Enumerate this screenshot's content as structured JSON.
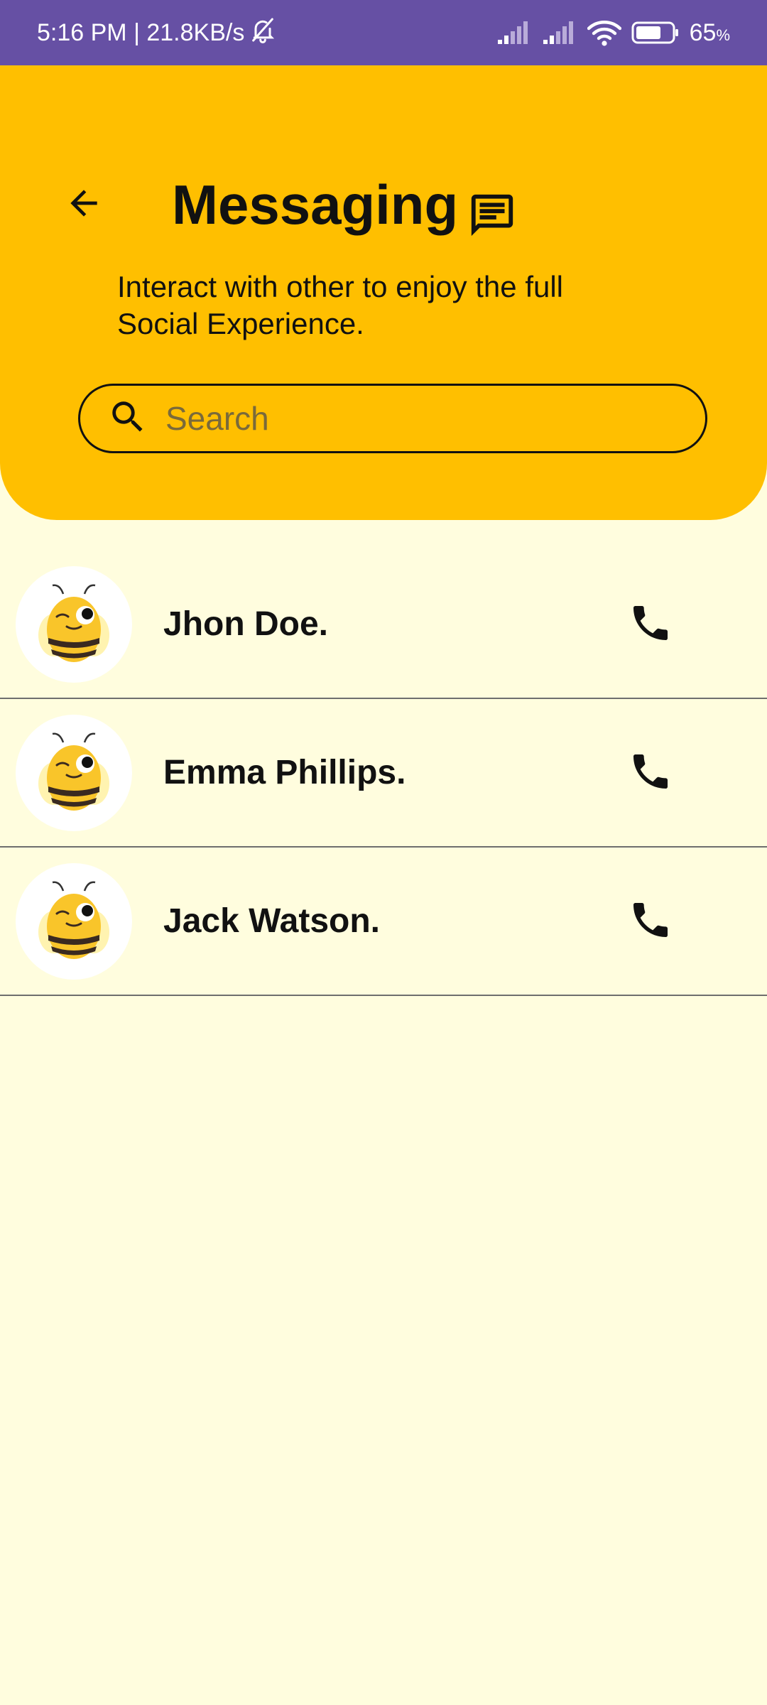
{
  "status_bar": {
    "time_speed": "5:16 PM | 21.8KB/s",
    "battery_percent": "65",
    "battery_unit": "%",
    "icons": [
      "bell-off-icon",
      "signal-icon",
      "signal-icon",
      "wifi-icon",
      "battery-icon"
    ]
  },
  "header": {
    "title": "Messaging",
    "subtitle": "Interact with other to enjoy the full Social Experience.",
    "back_icon": "arrow-left-icon",
    "title_icon": "chat-icon",
    "accent_color": "#FFBF00"
  },
  "search": {
    "placeholder": "Search",
    "value": "",
    "icon": "search-icon"
  },
  "contacts": [
    {
      "name": "Jhon Doe.",
      "avatar": "bee-avatar",
      "action_icon": "phone-icon"
    },
    {
      "name": "Emma Phillips.",
      "avatar": "bee-avatar",
      "action_icon": "phone-icon"
    },
    {
      "name": "Jack Watson.",
      "avatar": "bee-avatar",
      "action_icon": "phone-icon"
    }
  ],
  "colors": {
    "status_bar": "#6650A4",
    "background": "#FFFDDE",
    "header": "#FFBF00"
  }
}
